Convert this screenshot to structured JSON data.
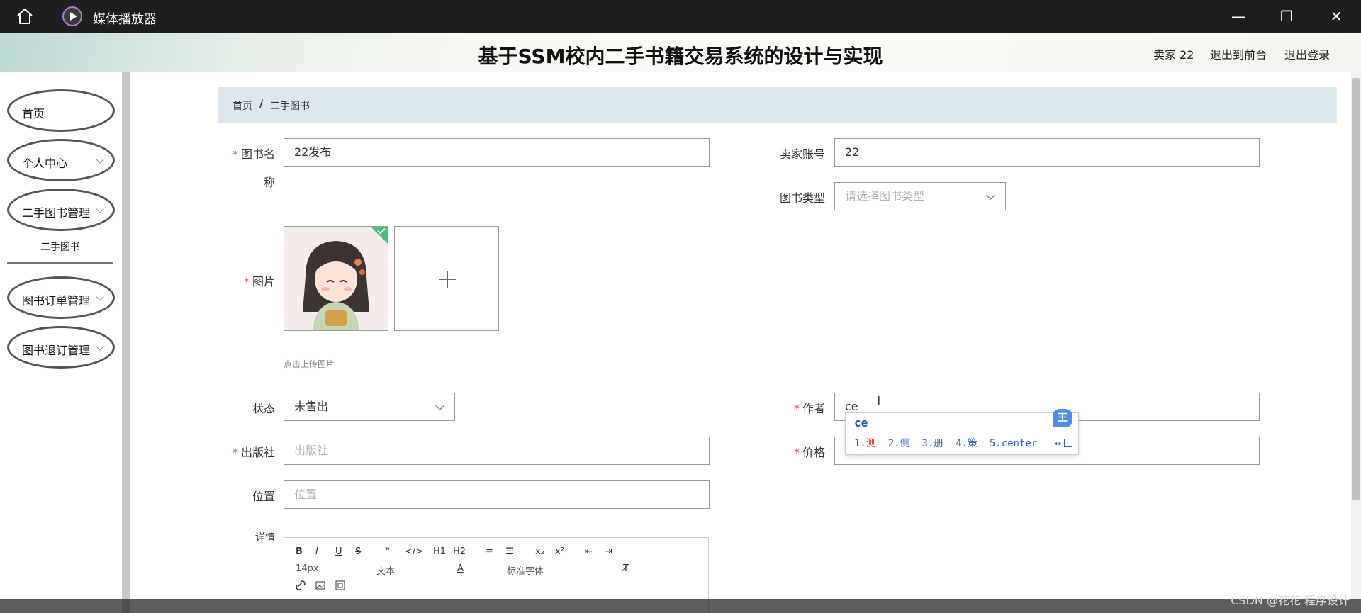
{
  "window": {
    "app_title": "媒体播放器",
    "minimize": "—",
    "restore": "❐",
    "close": "✕"
  },
  "header": {
    "system_title": "基于SSM校内二手书籍交易系统的设计与实现",
    "user": "卖家 22",
    "exit_front": "退出到前台",
    "logout": "退出登录"
  },
  "sidebar": {
    "items": [
      {
        "label": "首页"
      },
      {
        "label": "个人中心"
      },
      {
        "label": "二手图书管理"
      },
      {
        "label": "图书订单管理"
      },
      {
        "label": "图书退订管理"
      }
    ],
    "sub_item": "二手图书"
  },
  "breadcrumb": {
    "home": "首页",
    "sep": "/",
    "current": "二手图书"
  },
  "form": {
    "book_name_label_1": "图书名",
    "book_name_label_2": "称",
    "book_name_value": "22发布",
    "seller_account_label": "卖家账号",
    "seller_account_value": "22",
    "book_type_label": "图书类型",
    "book_type_placeholder": "请选择图书类型",
    "image_label": "图片",
    "upload_hint": "点击上传图片",
    "status_label": "状态",
    "status_value": "未售出",
    "author_label": "作者",
    "author_value": "ce",
    "publisher_label": "出版社",
    "publisher_placeholder": "出版社",
    "price_label": "价格",
    "price_placeholder": "价格",
    "location_label": "位置",
    "location_placeholder": "位置",
    "details_label": "详情",
    "required_mark": "*"
  },
  "ime": {
    "composition": "ce",
    "candidates": [
      "1.测",
      "2.侧",
      "3.册",
      "4.策",
      "5.center"
    ],
    "badge": "王"
  },
  "editor_toolbar": {
    "row1": [
      "B",
      "I",
      "U",
      "S",
      "❞",
      "</>",
      "H1",
      "H2",
      "≡",
      "☰",
      "x₂",
      "x²",
      "⇤",
      "⇥"
    ],
    "font_size": "14px",
    "text_type": "文本",
    "font_family": "标准字体",
    "color_a": "A",
    "clear": "T̸"
  },
  "watermark": "CSDN @花花 程序设计",
  "colors": {
    "titlebar": "#1e1e1e",
    "breadcrumb_bg": "#dce8ee",
    "required": "#e0404a",
    "ime_blue": "#4a8ff0"
  }
}
